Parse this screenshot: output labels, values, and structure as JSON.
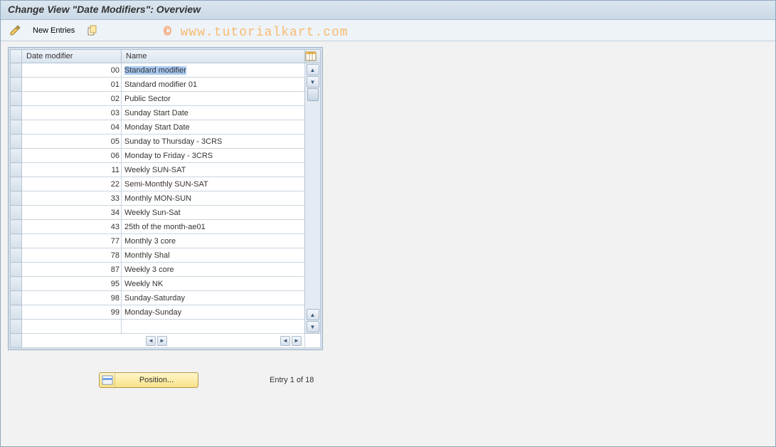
{
  "title": "Change View \"Date Modifiers\": Overview",
  "toolbar": {
    "new_entries_label": "New Entries"
  },
  "watermark": "www.tutorialkart.com",
  "table": {
    "columns": {
      "modifier": "Date modifier",
      "name": "Name"
    },
    "rows": [
      {
        "id": "00",
        "name": "Standard modifier",
        "selected": true
      },
      {
        "id": "01",
        "name": "Standard modifier 01"
      },
      {
        "id": "02",
        "name": "Public Sector"
      },
      {
        "id": "03",
        "name": "Sunday Start Date"
      },
      {
        "id": "04",
        "name": "Monday Start Date"
      },
      {
        "id": "05",
        "name": "Sunday to Thursday - 3CRS"
      },
      {
        "id": "06",
        "name": "Monday to Friday - 3CRS"
      },
      {
        "id": "11",
        "name": "Weekly SUN-SAT"
      },
      {
        "id": "22",
        "name": "Semi-Monthly SUN-SAT"
      },
      {
        "id": "33",
        "name": "Monthly MON-SUN"
      },
      {
        "id": "34",
        "name": "Weekly Sun-Sat"
      },
      {
        "id": "43",
        "name": "25th of the month-ae01"
      },
      {
        "id": "77",
        "name": "Monthly 3 core"
      },
      {
        "id": "78",
        "name": "Monthly Shal"
      },
      {
        "id": "87",
        "name": "Weekly 3 core"
      },
      {
        "id": "95",
        "name": "Weekly NK"
      },
      {
        "id": "98",
        "name": "Sunday-Saturday"
      },
      {
        "id": "99",
        "name": "Monday-Sunday"
      }
    ]
  },
  "footer": {
    "position_label": "Position...",
    "entry_text": "Entry 1 of 18"
  }
}
